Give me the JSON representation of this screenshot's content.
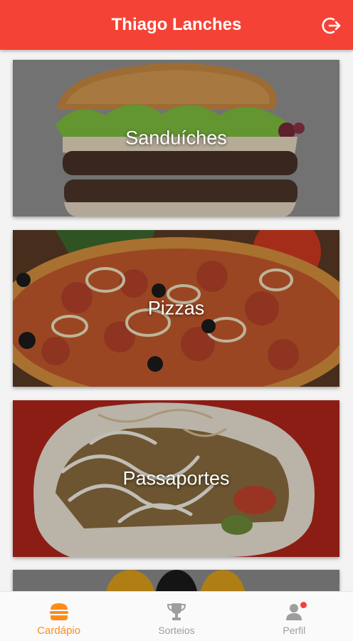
{
  "header": {
    "title": "Thiago Lanches",
    "logout_icon": "logout-icon"
  },
  "categories": [
    {
      "label": "Sanduíches"
    },
    {
      "label": "Pizzas"
    },
    {
      "label": "Passaportes"
    },
    {
      "label": ""
    }
  ],
  "bottom_nav": [
    {
      "label": "Cardápio",
      "icon": "burger-icon",
      "active": true
    },
    {
      "label": "Sorteios",
      "icon": "trophy-icon",
      "active": false
    },
    {
      "label": "Perfil",
      "icon": "person-icon",
      "active": false
    }
  ],
  "colors": {
    "primary": "#f44336",
    "active_nav": "#ff8c1a",
    "inactive_nav": "#9e9e9e"
  }
}
